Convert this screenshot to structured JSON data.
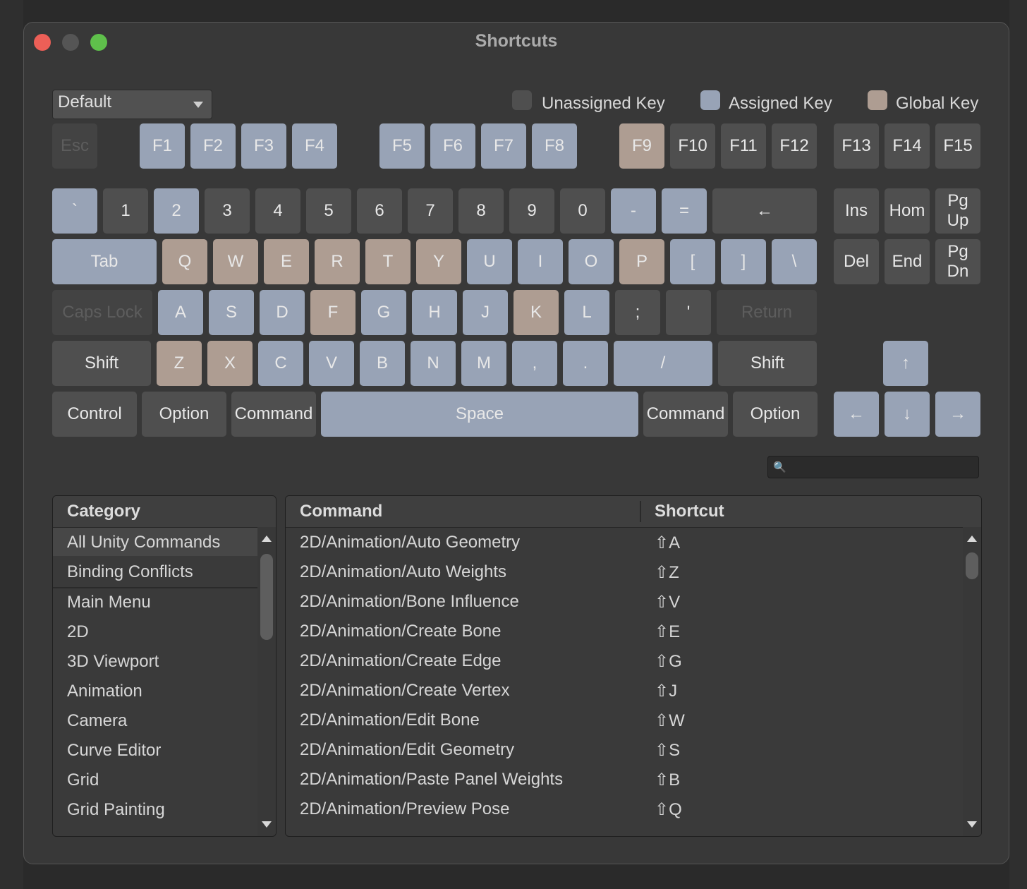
{
  "window": {
    "title": "Shortcuts"
  },
  "colors": {
    "unassigned": "#4f4f4f",
    "assigned": "#98a3b6",
    "global": "#ae9d92",
    "disabled": "#434343"
  },
  "profile_dropdown": {
    "value": "Default"
  },
  "legend": [
    {
      "label": "Unassigned Key",
      "type": "unassigned"
    },
    {
      "label": "Assigned Key",
      "type": "assigned"
    },
    {
      "label": "Global Key",
      "type": "global"
    }
  ],
  "keys": [
    {
      "label": "Esc",
      "t": "d"
    },
    {
      "label": "F1",
      "t": "a"
    },
    {
      "label": "F2",
      "t": "a"
    },
    {
      "label": "F3",
      "t": "a"
    },
    {
      "label": "F4",
      "t": "a"
    },
    {
      "label": "F5",
      "t": "a"
    },
    {
      "label": "F6",
      "t": "a"
    },
    {
      "label": "F7",
      "t": "a"
    },
    {
      "label": "F8",
      "t": "a"
    },
    {
      "label": "F9",
      "t": "g"
    },
    {
      "label": "F10",
      "t": "u"
    },
    {
      "label": "F11",
      "t": "u"
    },
    {
      "label": "F12",
      "t": "u"
    },
    {
      "label": "F13",
      "t": "u"
    },
    {
      "label": "F14",
      "t": "u"
    },
    {
      "label": "F15",
      "t": "u"
    },
    {
      "label": "`",
      "t": "a"
    },
    {
      "label": "1",
      "t": "u"
    },
    {
      "label": "2",
      "t": "a"
    },
    {
      "label": "3",
      "t": "u"
    },
    {
      "label": "4",
      "t": "u"
    },
    {
      "label": "5",
      "t": "u"
    },
    {
      "label": "6",
      "t": "u"
    },
    {
      "label": "7",
      "t": "u"
    },
    {
      "label": "8",
      "t": "u"
    },
    {
      "label": "9",
      "t": "u"
    },
    {
      "label": "0",
      "t": "u"
    },
    {
      "label": "-",
      "t": "a"
    },
    {
      "label": "=",
      "t": "a"
    },
    {
      "label": "←",
      "t": "u"
    },
    {
      "label": "Ins",
      "t": "u"
    },
    {
      "label": "Hom",
      "t": "u"
    },
    {
      "label": "Pg\nUp",
      "t": "u"
    },
    {
      "label": "Tab",
      "t": "a"
    },
    {
      "label": "Q",
      "t": "g"
    },
    {
      "label": "W",
      "t": "g"
    },
    {
      "label": "E",
      "t": "g"
    },
    {
      "label": "R",
      "t": "g"
    },
    {
      "label": "T",
      "t": "g"
    },
    {
      "label": "Y",
      "t": "g"
    },
    {
      "label": "U",
      "t": "a"
    },
    {
      "label": "I",
      "t": "a"
    },
    {
      "label": "O",
      "t": "a"
    },
    {
      "label": "P",
      "t": "g"
    },
    {
      "label": "[",
      "t": "a"
    },
    {
      "label": "]",
      "t": "a"
    },
    {
      "label": "\\",
      "t": "a"
    },
    {
      "label": "Del",
      "t": "u"
    },
    {
      "label": "End",
      "t": "u"
    },
    {
      "label": "Pg\nDn",
      "t": "u"
    },
    {
      "label": "Caps Lock",
      "t": "d"
    },
    {
      "label": "A",
      "t": "a"
    },
    {
      "label": "S",
      "t": "a"
    },
    {
      "label": "D",
      "t": "a"
    },
    {
      "label": "F",
      "t": "g"
    },
    {
      "label": "G",
      "t": "a"
    },
    {
      "label": "H",
      "t": "a"
    },
    {
      "label": "J",
      "t": "a"
    },
    {
      "label": "K",
      "t": "g"
    },
    {
      "label": "L",
      "t": "a"
    },
    {
      "label": ";",
      "t": "u"
    },
    {
      "label": "'",
      "t": "u"
    },
    {
      "label": "Return",
      "t": "d"
    },
    {
      "label": "Shift",
      "t": "u"
    },
    {
      "label": "Z",
      "t": "g"
    },
    {
      "label": "X",
      "t": "g"
    },
    {
      "label": "C",
      "t": "a"
    },
    {
      "label": "V",
      "t": "a"
    },
    {
      "label": "B",
      "t": "a"
    },
    {
      "label": "N",
      "t": "a"
    },
    {
      "label": "M",
      "t": "a"
    },
    {
      "label": ",",
      "t": "a"
    },
    {
      "label": ".",
      "t": "a"
    },
    {
      "label": "/",
      "t": "a"
    },
    {
      "label": "Shift",
      "t": "u"
    },
    {
      "label": "↑",
      "t": "a"
    },
    {
      "label": "Control",
      "t": "u"
    },
    {
      "label": "Option",
      "t": "u"
    },
    {
      "label": "Command",
      "t": "u"
    },
    {
      "label": "Space",
      "t": "a"
    },
    {
      "label": "Command",
      "t": "u"
    },
    {
      "label": "Option",
      "t": "u"
    },
    {
      "label": "←",
      "t": "a"
    },
    {
      "label": "↓",
      "t": "a"
    },
    {
      "label": "→",
      "t": "a"
    }
  ],
  "category_panel": {
    "header": "Category",
    "items": [
      "All Unity Commands",
      "Binding Conflicts",
      "Main Menu",
      "2D",
      "3D Viewport",
      "Animation",
      "Camera",
      "Curve Editor",
      "Grid",
      "Grid Painting"
    ],
    "selected": "All Unity Commands"
  },
  "command_panel": {
    "col_command": "Command",
    "col_shortcut": "Shortcut",
    "rows": [
      {
        "command": "2D/Animation/Auto Geometry",
        "shortcut": "⇧A"
      },
      {
        "command": "2D/Animation/Auto Weights",
        "shortcut": "⇧Z"
      },
      {
        "command": "2D/Animation/Bone Influence",
        "shortcut": "⇧V"
      },
      {
        "command": "2D/Animation/Create Bone",
        "shortcut": "⇧E"
      },
      {
        "command": "2D/Animation/Create Edge",
        "shortcut": "⇧G"
      },
      {
        "command": "2D/Animation/Create Vertex",
        "shortcut": "⇧J"
      },
      {
        "command": "2D/Animation/Edit Bone",
        "shortcut": "⇧W"
      },
      {
        "command": "2D/Animation/Edit Geometry",
        "shortcut": "⇧S"
      },
      {
        "command": "2D/Animation/Paste Panel Weights",
        "shortcut": "⇧B"
      },
      {
        "command": "2D/Animation/Preview Pose",
        "shortcut": "⇧Q"
      }
    ]
  }
}
